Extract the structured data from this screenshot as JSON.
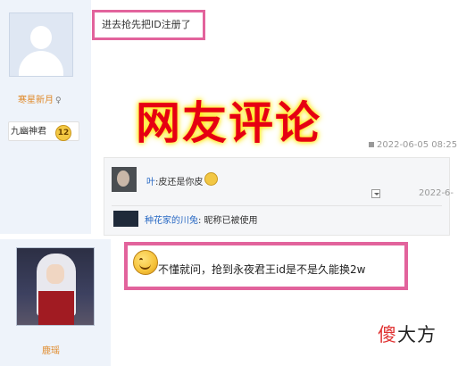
{
  "post1": {
    "user_name": "寒星新月",
    "gender_symbol": "♀",
    "medal_label": "九幽神君",
    "medal_level": "12",
    "content": "进去抢先把ID注册了",
    "date": "2022-06-05 08:25"
  },
  "headline": "网友评论",
  "replies": [
    {
      "user": "叶",
      "text": ":皮还是你皮",
      "date": "2022-6-"
    },
    {
      "user": "种花家的川兔",
      "text": ": 昵称已被使用"
    }
  ],
  "post2": {
    "user_name": "鹿瑶",
    "content": "不懂就问，抢到永夜君王id是不是久能换2w"
  },
  "watermark": {
    "red_part": "傻",
    "dark_part": "大方"
  }
}
